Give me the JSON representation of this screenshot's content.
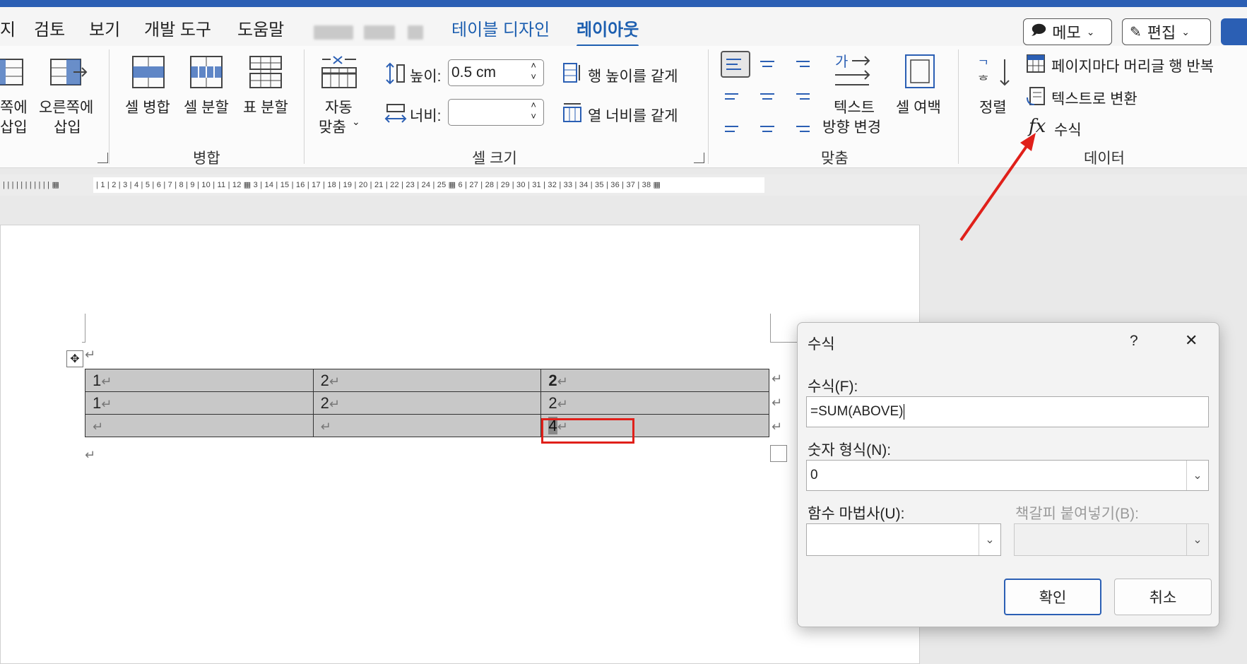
{
  "tabs": {
    "t0": "지",
    "t1": "검토",
    "t2": "보기",
    "t3": "개발 도구",
    "t4": "도움말",
    "t5": "테이블 디자인",
    "t6": "레이아웃"
  },
  "topbuttons": {
    "memo": "메모",
    "edit": "편집"
  },
  "ribbon": {
    "insert_right": "오른쪽에",
    "insert_right2": "삽입",
    "insert_left_partial": "쪽에",
    "insert_left_partial2": "삽입",
    "merge_cells": "셀 병합",
    "split_cells": "셀 분할",
    "split_table": "표 분할",
    "group_merge": "병합",
    "autofit": "자동",
    "autofit2": "맞춤",
    "height_label": "높이:",
    "height_value": "0.5 cm",
    "width_label": "너비:",
    "width_value": "",
    "distribute_rows": "행 높이를 같게",
    "distribute_cols": "열 너비를 같게",
    "group_cellsize": "셀 크기",
    "text_direction": "텍스트",
    "text_direction2": "방향 변경",
    "cell_margins": "셀 여백",
    "group_align": "맞춤",
    "sort": "정렬",
    "repeat_header": "페이지마다 머리글 행 반복",
    "convert_text": "텍스트로 변환",
    "formula": "수식",
    "group_data": "데이터"
  },
  "ruler": "| 1 | 2 | 3 | 4 | 5 | 6 | 7 | 8 | 9 | 10 | 11 | 12 ▦ 3 | 14 | 15 | 16 | 17 | 18 | 19 | 20 | 21 | 22 | 23 | 24 | 25 ▦ 6 | 27 | 28 | 29 | 30 | 31 | 32 | 33 | 34 | 35 | 36 | 37 | 38 ▦",
  "table": {
    "rows": [
      [
        "1",
        "2",
        "2"
      ],
      [
        "1",
        "2",
        "2"
      ],
      [
        "",
        "",
        "4"
      ]
    ],
    "para_mark": "↵"
  },
  "dialog": {
    "title": "수식",
    "help": "?",
    "close": "✕",
    "formula_label": "수식(F):",
    "formula_value": "=SUM(ABOVE)",
    "number_format_label": "숫자 형식(N):",
    "number_format_value": "0",
    "paste_function_label": "함수 마법사(U):",
    "paste_function_value": "",
    "paste_bookmark_label": "책갈피 붙여넣기(B):",
    "paste_bookmark_value": "",
    "ok": "확인",
    "cancel": "취소"
  },
  "colors": {
    "accent": "#2b5fb4",
    "highlight": "#e0201a",
    "cell_shade": "#c8c8c8"
  }
}
